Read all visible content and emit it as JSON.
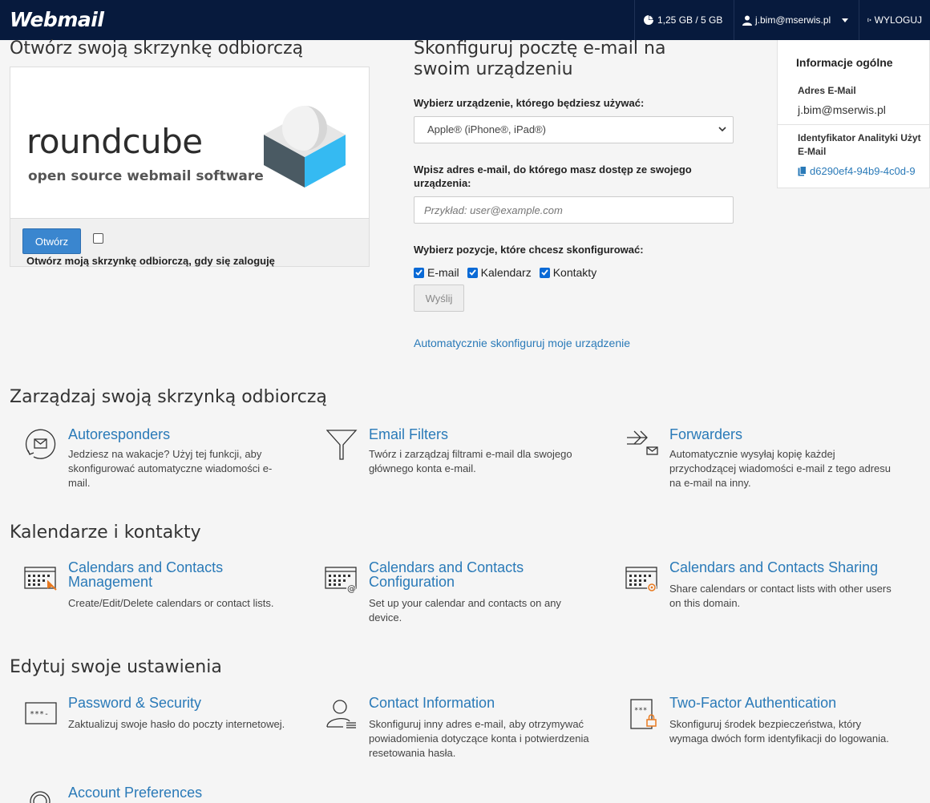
{
  "topbar": {
    "brand": "Webmail",
    "quota": "1,25 GB / 5 GB",
    "user": "j.bim@mserwis.pl",
    "logout": "WYLOGUJ"
  },
  "open_inbox": {
    "title": "Otwórz swoją skrzynkę odbiorczą",
    "logo_word": "roundcube",
    "logo_sub": "open source webmail software",
    "open_button": "Otwórz",
    "auto_open_label": "Otwórz moją skrzynkę odbiorczą, gdy się zaloguję"
  },
  "configure": {
    "title": "Skonfiguruj pocztę e-mail na swoim urządzeniu",
    "device_label": "Wybierz urządzenie, którego będziesz używać:",
    "device_selected": "Apple® (iPhone®, iPad®)",
    "email_label": "Wpisz adres e-mail, do którego masz dostęp ze swojego urządzenia:",
    "email_placeholder": "Przykład: user@example.com",
    "items_label": "Wybierz pozycje, które chcesz skonfigurować:",
    "items": [
      "E-mail",
      "Kalendarz",
      "Kontakty"
    ],
    "send_button": "Wyślij",
    "auto_link": "Automatycznie skonfiguruj moje urządzenie"
  },
  "info": {
    "title": "Informacje ogólne",
    "email_label": "Adres E-Mail",
    "email_value": "j.bim@mserwis.pl",
    "analytics_label_line1": "Identyfikator Analityki Użyt",
    "analytics_label_line2": "E-Mail",
    "analytics_value": "d6290ef4-94b9-4c0d-9"
  },
  "sections": {
    "manage": {
      "title": "Zarządzaj swoją skrzynką odbiorczą",
      "tiles": [
        {
          "name": "Autoresponders",
          "icon": "autoresponder-icon",
          "desc": "Jedziesz na wakacje? Użyj tej funkcji, aby skonfigurować automatyczne wiadomości e-mail."
        },
        {
          "name": "Email Filters",
          "icon": "filter-icon",
          "desc": "Twórz i zarządzaj filtrami e-mail dla swojego głównego konta e-mail."
        },
        {
          "name": "Forwarders",
          "icon": "forwarder-icon",
          "desc": "Automatycznie wysyłaj kopię każdej przychodzącej wiadomości e-mail z tego adresu na e-mail na inny."
        }
      ]
    },
    "calendars": {
      "title": "Kalendarze i kontakty",
      "tiles": [
        {
          "name_line1": "Calendars and Contacts",
          "name_line2": "Management",
          "icon": "calendar-manage-icon",
          "desc": "Create/Edit/Delete calendars or contact lists."
        },
        {
          "name_line1": "Calendars and Contacts",
          "name_line2": "Configuration",
          "icon": "calendar-config-icon",
          "desc": "Set up your calendar and contacts on any device."
        },
        {
          "name": "Calendars and Contacts Sharing",
          "icon": "calendar-share-icon",
          "desc": "Share calendars or contact lists with other users on this domain."
        }
      ]
    },
    "settings": {
      "title": "Edytuj swoje ustawienia",
      "tiles": [
        {
          "name": "Password & Security",
          "icon": "password-icon",
          "desc": "Zaktualizuj swoje hasło do poczty internetowej."
        },
        {
          "name": "Contact Information",
          "icon": "contact-icon",
          "desc": "Skonfiguruj inny adres e-mail, aby otrzymywać powiadomienia dotyczące konta i potwierdzenia resetowania hasła."
        },
        {
          "name": "Two-Factor Authentication",
          "icon": "two-factor-icon",
          "desc": "Skonfiguruj środek bezpieczeństwa, który wymaga dwóch form identyfikacji do logowania."
        },
        {
          "name": "Account Preferences",
          "icon": "preferences-icon"
        }
      ]
    }
  },
  "colors": {
    "topbar": "#071a3d",
    "link": "#2a7ab8",
    "primary_button": "#3a86cf",
    "accent_orange": "#e8791f"
  }
}
